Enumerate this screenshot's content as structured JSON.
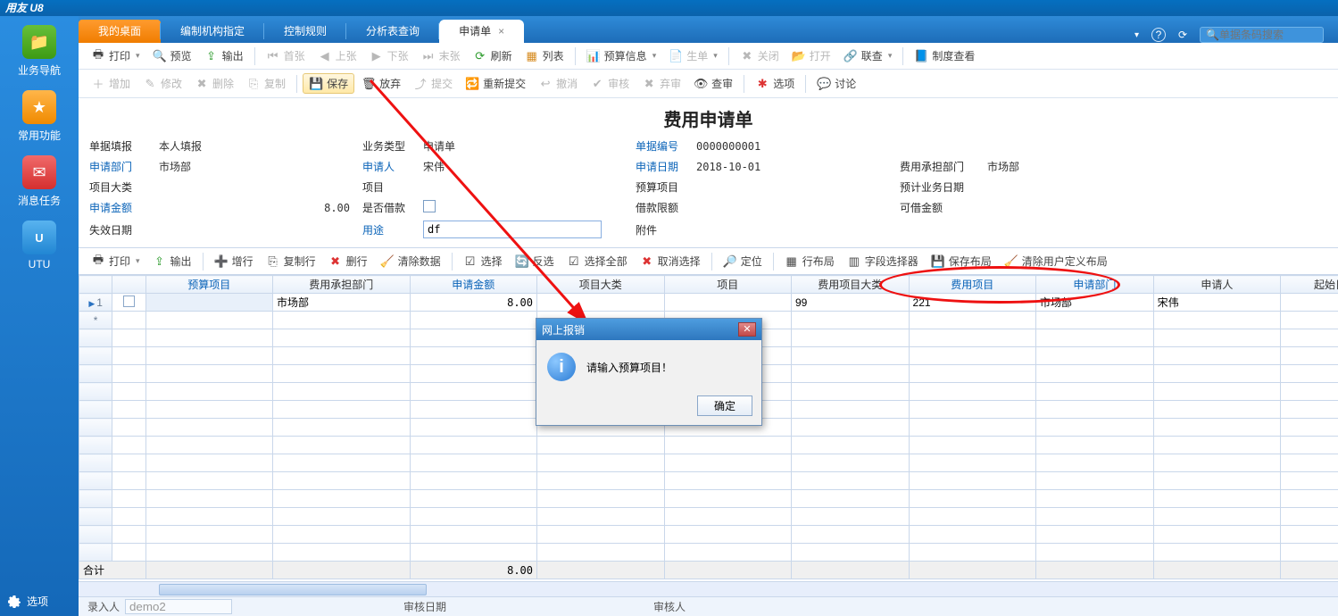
{
  "app_title": "用友 U8",
  "sidebar": {
    "items": [
      {
        "label": "业务导航",
        "icon": "folder"
      },
      {
        "label": "常用功能",
        "icon": "star"
      },
      {
        "label": "消息任务",
        "icon": "mail"
      },
      {
        "label": "UTU",
        "icon": "utu"
      }
    ],
    "options_label": "选项"
  },
  "tabs": {
    "items": [
      {
        "label": "我的桌面"
      },
      {
        "label": "编制机构指定"
      },
      {
        "label": "控制规则"
      },
      {
        "label": "分析表查询"
      },
      {
        "label": "申请单",
        "active": true
      }
    ],
    "help_icon": "?",
    "search_placeholder": "单据条码搜索"
  },
  "tb1": {
    "print": "打印",
    "preview": "预览",
    "output": "输出",
    "first": "首张",
    "prev": "上张",
    "next": "下张",
    "last": "末张",
    "refresh": "刷新",
    "list": "列表",
    "budget": "预算信息",
    "newbill": "生单",
    "close": "关闭",
    "open": "打开",
    "related": "联查",
    "policy": "制度查看"
  },
  "tb2": {
    "add": "增加",
    "edit": "修改",
    "del": "删除",
    "copy": "复制",
    "save": "保存",
    "abandon": "放弃",
    "submit": "提交",
    "resubmit": "重新提交",
    "revoke": "撤消",
    "audit": "审核",
    "discard": "弃审",
    "review": "查审",
    "option": "选项",
    "discuss": "讨论"
  },
  "doc": {
    "title": "费用申请单",
    "fields": {
      "fill_label": "单据填报",
      "fill_value": "本人填报",
      "biztype_label": "业务类型",
      "biztype_value": "申请单",
      "billno_label": "单据编号",
      "billno_value": "0000000001",
      "dept_label": "申请部门",
      "dept_value": "市场部",
      "applicant_label": "申请人",
      "applicant_value": "宋伟",
      "date_label": "申请日期",
      "date_value": "2018-10-01",
      "bear_label": "费用承担部门",
      "bear_value": "市场部",
      "projcat_label": "项目大类",
      "projcat_value": "",
      "proj_label": "项目",
      "proj_value": "",
      "budget_label": "预算项目",
      "budget_value": "",
      "plandate_label": "预计业务日期",
      "plandate_value": "",
      "amount_label": "申请金额",
      "amount_value": "8.00",
      "isloan_label": "是否借款",
      "isloan_value": false,
      "loanlimit_label": "借款限额",
      "loanlimit_value": "",
      "canloan_label": "可借金额",
      "canloan_value": "",
      "expire_label": "失效日期",
      "expire_value": "",
      "purpose_label": "用途",
      "purpose_value": "df",
      "attach_label": "附件",
      "attach_value": ""
    }
  },
  "gridbar": {
    "print": "打印",
    "output": "输出",
    "addrow": "增行",
    "copyrow": "复制行",
    "delrow": "删行",
    "cleardata": "清除数据",
    "select": "选择",
    "invert": "反选",
    "selall": "选择全部",
    "unselall": "取消选择",
    "locate": "定位",
    "rowlayout": "行布局",
    "fieldsel": "字段选择器",
    "savelayout": "保存布局",
    "clearlayout": "清除用户定义布局"
  },
  "grid": {
    "cols": [
      "",
      "",
      "预算项目",
      "费用承担部门",
      "申请金额",
      "项目大类",
      "项目",
      "费用项目大类",
      "费用项目",
      "申请部门",
      "申请人",
      "起始日期"
    ],
    "rows": [
      {
        "n": "1",
        "chk": false,
        "budget": "",
        "dept": "市场部",
        "amount": "8.00",
        "projcat": "",
        "proj": "",
        "feecat": "99",
        "feeitem": "221",
        "appdept": "市场部",
        "applicant": "宋伟",
        "start": ""
      }
    ],
    "star": "*",
    "sum_label": "合计",
    "sum_amount": "8.00"
  },
  "status": {
    "entry_label": "录入人",
    "entry_value": "demo2",
    "auditdate_label": "审核日期",
    "auditor_label": "审核人"
  },
  "modal": {
    "title": "网上报销",
    "msg": "请输入预算项目！",
    "ok": "确定"
  }
}
